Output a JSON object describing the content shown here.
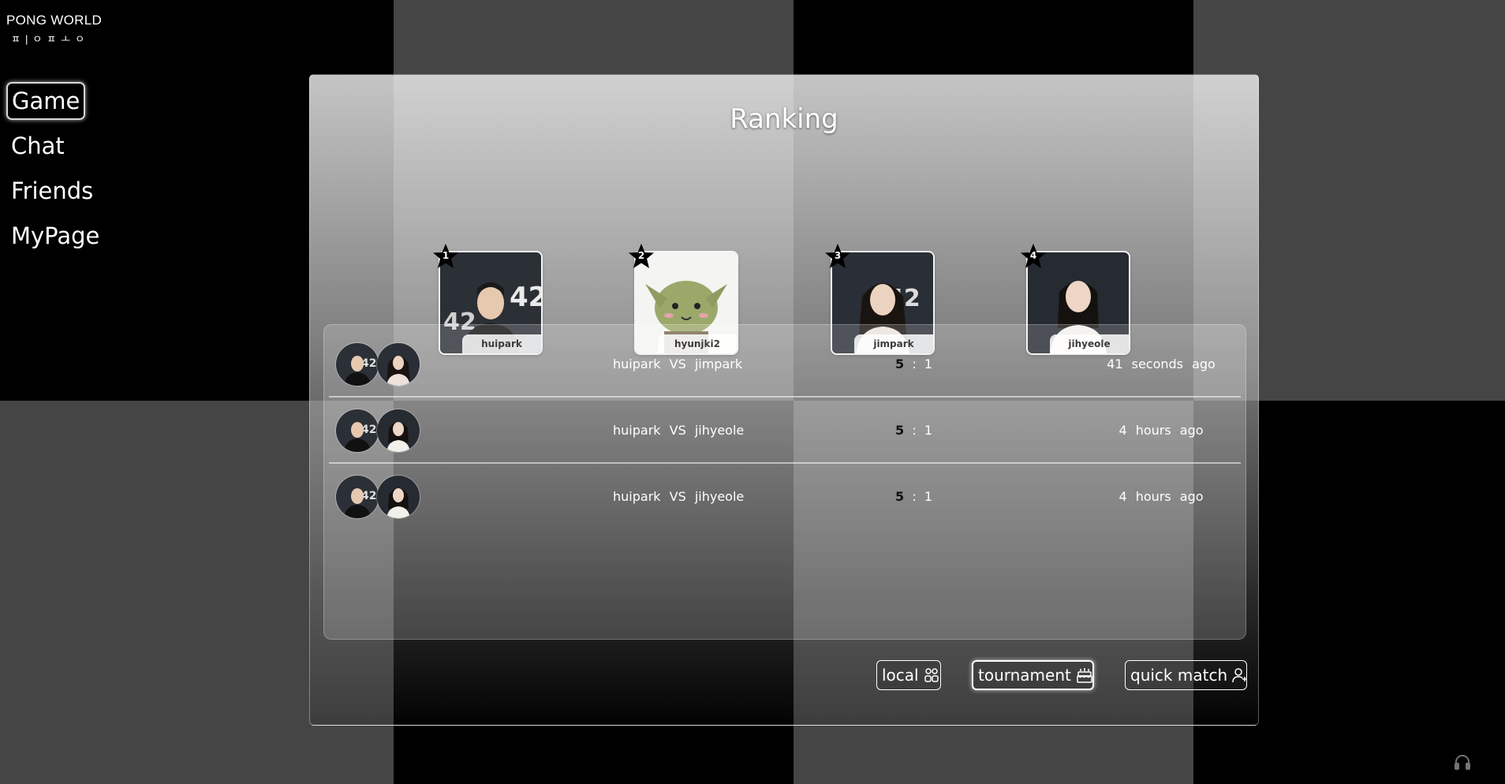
{
  "app": {
    "logo_title": "PONG WORLD",
    "logo_subtitle": "ㅍ|ㅇㅍㅗㅇ"
  },
  "nav": {
    "items": [
      {
        "label": "Game",
        "active": true
      },
      {
        "label": "Chat",
        "active": false
      },
      {
        "label": "Friends",
        "active": false
      },
      {
        "label": "MyPage",
        "active": false
      }
    ]
  },
  "ranking": {
    "title": "Ranking",
    "players": [
      {
        "rank": "1",
        "name": "huipark"
      },
      {
        "rank": "2",
        "name": "hyunjki2"
      },
      {
        "rank": "3",
        "name": "jimpark"
      },
      {
        "rank": "4",
        "name": "jihyeole"
      }
    ]
  },
  "history": {
    "rows": [
      {
        "player1": "huipark",
        "vs": "VS",
        "player2": "jimpark",
        "score_winner": "5",
        "score_sep": ":",
        "score_loser": "1",
        "time": "41 seconds ago"
      },
      {
        "player1": "huipark",
        "vs": "VS",
        "player2": "jihyeole",
        "score_winner": "5",
        "score_sep": ":",
        "score_loser": "1",
        "time": "4 hours ago"
      },
      {
        "player1": "huipark",
        "vs": "VS",
        "player2": "jihyeole",
        "score_winner": "5",
        "score_sep": ":",
        "score_loser": "1",
        "time": "4 hours ago"
      }
    ]
  },
  "buttons": {
    "local": "local",
    "tournament": "tournament",
    "quick_match": "quick match"
  },
  "icons": {
    "local": "users-grid-icon",
    "tournament": "cake-icon",
    "quick_match": "user-plus-icon",
    "footer": "headset-icon"
  }
}
